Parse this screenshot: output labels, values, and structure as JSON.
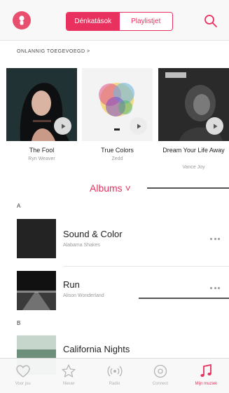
{
  "header": {
    "segments": [
      {
        "label": "Dénkatások",
        "active": true
      },
      {
        "label": "Playlistjet",
        "active": false
      }
    ]
  },
  "recently_added": {
    "title": "ONLANNIG TOEGEVOEGD >",
    "items": [
      {
        "title": "The Fool",
        "artist": "Ryn Weaver"
      },
      {
        "title": "True Colors",
        "artist": "Zedd"
      },
      {
        "title": "Dream Your Life Away",
        "artist": "Vance Joy"
      }
    ]
  },
  "albums": {
    "header": "Albums ˅",
    "sections": [
      {
        "letter": "A"
      },
      {
        "letter": "B"
      }
    ],
    "items": [
      {
        "title": "Sound & Color",
        "artist": "Alabama Shakes"
      },
      {
        "title": "Run",
        "artist": "Alison Wonderland"
      },
      {
        "title": "California Nights",
        "artist": ""
      }
    ]
  },
  "tabbar": {
    "items": [
      {
        "label": "Voor jou",
        "icon": "heart-icon"
      },
      {
        "label": "Nieuw",
        "icon": "star-icon"
      },
      {
        "label": "Radio",
        "icon": "radio-icon"
      },
      {
        "label": "Connect",
        "icon": "at-icon"
      },
      {
        "label": "Mijn muziek",
        "icon": "music-note-icon",
        "active": true
      }
    ]
  },
  "colors": {
    "accent": "#e8315f",
    "profile": "#e84e6e"
  }
}
